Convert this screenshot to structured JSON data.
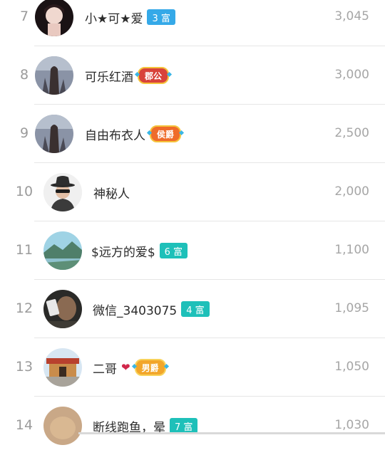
{
  "leaderboard": {
    "rows": [
      {
        "rank": "7",
        "name": "小★可★爱",
        "badge": "3 富",
        "badge_type": "fu-blue",
        "score": "3,045"
      },
      {
        "rank": "8",
        "name": "可乐红酒",
        "badge": "郡公",
        "badge_type": "rank-red",
        "score": "3,000"
      },
      {
        "rank": "9",
        "name": "自由布衣人",
        "badge": "侯爵",
        "badge_type": "rank-orange",
        "score": "2,500"
      },
      {
        "rank": "10",
        "name": "神秘人",
        "badge": "",
        "badge_type": "none",
        "score": "2,000"
      },
      {
        "rank": "11",
        "name": "$远方的爱$",
        "badge": "6 富",
        "badge_type": "fu-teal",
        "score": "1,100"
      },
      {
        "rank": "12",
        "name": "微信_3403075",
        "badge": "4 富",
        "badge_type": "fu-teal",
        "score": "1,095"
      },
      {
        "rank": "13",
        "name": "二哥",
        "badge": "男爵",
        "badge_type": "rank-gold",
        "score": "1,050"
      },
      {
        "rank": "14",
        "name": "断线跑鱼，晕",
        "badge": "7 富",
        "badge_type": "fu-teal",
        "score": "1,030"
      }
    ]
  }
}
